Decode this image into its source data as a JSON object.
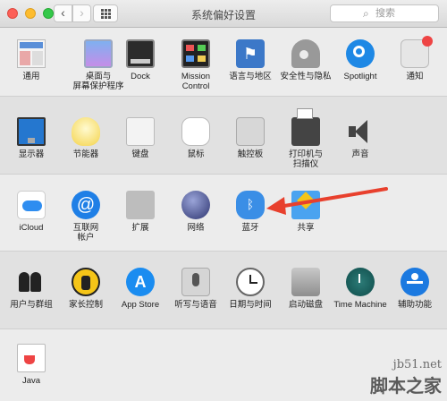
{
  "window": {
    "title": "系统偏好设置",
    "back_glyph": "‹",
    "forward_glyph": "›",
    "search_placeholder": "搜索",
    "search_glyph": "⌕"
  },
  "rows": {
    "personal": [
      {
        "label": "通用",
        "icon": "general-icon"
      },
      {
        "label": "桌面与\n屏幕保护程序",
        "icon": "desktop-screensaver-icon"
      },
      {
        "label": "Dock",
        "icon": "dock-icon"
      },
      {
        "label": "Mission\nControl",
        "icon": "mission-control-icon"
      },
      {
        "label": "语言与地区",
        "icon": "language-region-icon"
      },
      {
        "label": "安全性与隐私",
        "icon": "security-privacy-icon"
      },
      {
        "label": "Spotlight",
        "icon": "spotlight-icon"
      },
      {
        "label": "通知",
        "icon": "notifications-icon"
      }
    ],
    "hardware": [
      {
        "label": "显示器",
        "icon": "displays-icon"
      },
      {
        "label": "节能器",
        "icon": "energy-saver-icon"
      },
      {
        "label": "键盘",
        "icon": "keyboard-icon"
      },
      {
        "label": "鼠标",
        "icon": "mouse-icon"
      },
      {
        "label": "触控板",
        "icon": "trackpad-icon"
      },
      {
        "label": "打印机与\n扫描仪",
        "icon": "printers-scanners-icon"
      },
      {
        "label": "声音",
        "icon": "sound-icon"
      }
    ],
    "internet": [
      {
        "label": "iCloud",
        "icon": "icloud-icon"
      },
      {
        "label": "互联网\n帐户",
        "icon": "internet-accounts-icon",
        "glyph": "@"
      },
      {
        "label": "扩展",
        "icon": "extensions-icon"
      },
      {
        "label": "网络",
        "icon": "network-icon"
      },
      {
        "label": "蓝牙",
        "icon": "bluetooth-icon",
        "glyph": "ᛒ"
      },
      {
        "label": "共享",
        "icon": "sharing-icon"
      }
    ],
    "system": [
      {
        "label": "用户与群组",
        "icon": "users-groups-icon"
      },
      {
        "label": "家长控制",
        "icon": "parental-controls-icon"
      },
      {
        "label": "App Store",
        "icon": "app-store-icon",
        "glyph": "A"
      },
      {
        "label": "听写与语音",
        "icon": "dictation-speech-icon"
      },
      {
        "label": "日期与时间",
        "icon": "date-time-icon"
      },
      {
        "label": "启动磁盘",
        "icon": "startup-disk-icon"
      },
      {
        "label": "Time Machine",
        "icon": "time-machine-icon"
      },
      {
        "label": "辅助功能",
        "icon": "accessibility-icon"
      }
    ],
    "other": [
      {
        "label": "Java",
        "icon": "java-icon"
      }
    ]
  },
  "language_glyph": "⚑",
  "watermark": {
    "line1": "jb51.net",
    "line2": "脚本之家"
  },
  "colors": {
    "annotation_arrow": "#e8402d"
  }
}
